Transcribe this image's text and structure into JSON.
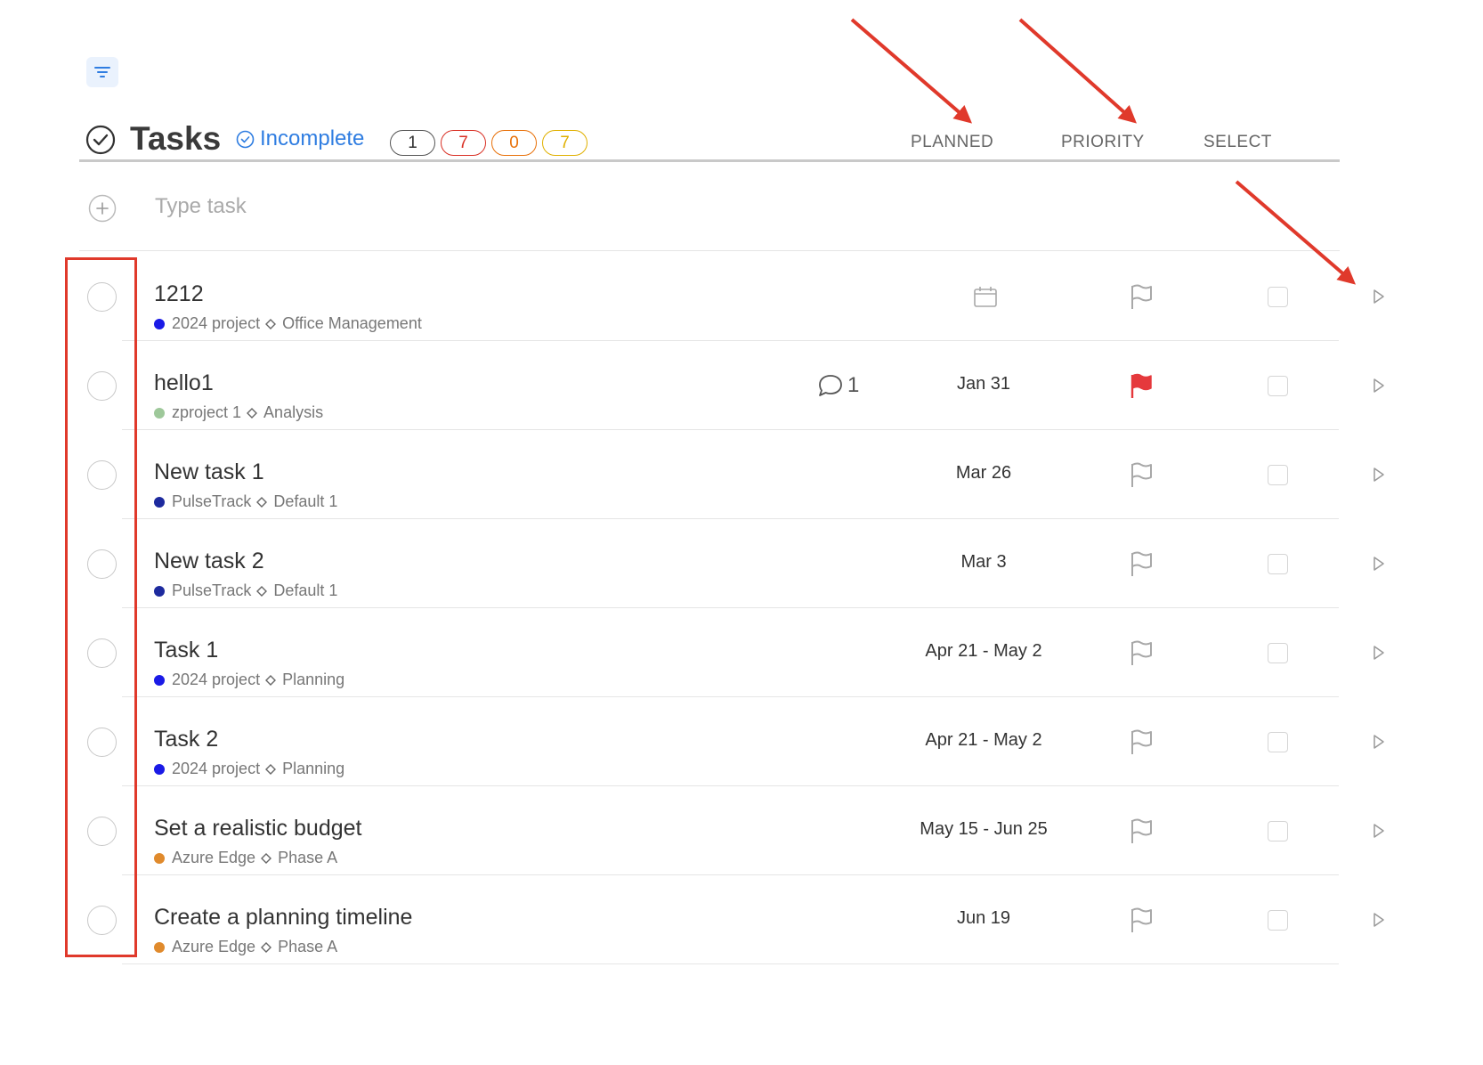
{
  "header": {
    "title": "Tasks",
    "filter_status": "Incomplete",
    "counts": [
      {
        "value": "1",
        "color": "#555555"
      },
      {
        "value": "7",
        "color": "#d93025"
      },
      {
        "value": "0",
        "color": "#e8710a"
      },
      {
        "value": "7",
        "color": "#e0b000"
      }
    ],
    "columns": {
      "planned": "PLANNED",
      "priority": "PRIORITY",
      "select": "SELECT"
    }
  },
  "add_task": {
    "placeholder": "Type task"
  },
  "tasks": [
    {
      "name": "1212",
      "project": "2024 project",
      "project_color": "#1a1ae6",
      "section": "Office Management",
      "comments": "",
      "planned": "",
      "priority_flag": "outline"
    },
    {
      "name": "hello1",
      "project": "zproject 1",
      "project_color": "#9ec89a",
      "section": "Analysis",
      "comments": "1",
      "planned": "Jan 31",
      "priority_flag": "red"
    },
    {
      "name": "New task 1",
      "project": "PulseTrack",
      "project_color": "#1d2a9e",
      "section": "Default 1",
      "comments": "",
      "planned": "Mar 26",
      "priority_flag": "outline"
    },
    {
      "name": "New task 2",
      "project": "PulseTrack",
      "project_color": "#1d2a9e",
      "section": "Default 1",
      "comments": "",
      "planned": "Mar 3",
      "priority_flag": "outline"
    },
    {
      "name": "Task 1",
      "project": "2024 project",
      "project_color": "#1a1ae6",
      "section": "Planning",
      "comments": "",
      "planned": "Apr 21 - May 2",
      "priority_flag": "outline"
    },
    {
      "name": "Task 2",
      "project": "2024 project",
      "project_color": "#1a1ae6",
      "section": "Planning",
      "comments": "",
      "planned": "Apr 21 - May 2",
      "priority_flag": "outline"
    },
    {
      "name": "Set a realistic budget",
      "project": "Azure Edge",
      "project_color": "#e08a2c",
      "section": "Phase A",
      "comments": "",
      "planned": "May 15 - Jun 25",
      "priority_flag": "outline"
    },
    {
      "name": "Create a planning timeline",
      "project": "Azure Edge",
      "project_color": "#e08a2c",
      "section": "Phase A",
      "comments": "",
      "planned": "Jun 19",
      "priority_flag": "outline"
    }
  ]
}
